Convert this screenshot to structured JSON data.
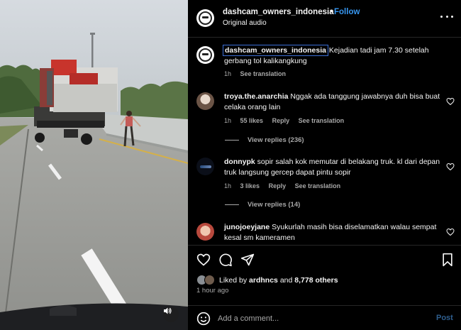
{
  "header": {
    "username": "dashcam_owners_indonesia",
    "separator": "•",
    "follow_label": "Follow",
    "audio_label": "Original audio",
    "more_icon": "more-horizontal-icon"
  },
  "caption": {
    "username": "dashcam_owners_indonesia",
    "text": "Kejadian tadi jam 7.30 setelah gerbang tol kalikangkung",
    "time": "1h",
    "see_translation": "See translation"
  },
  "comments": [
    {
      "username": "troya.the.anarchia",
      "text": "Nggak ada tanggung jawabnya duh bisa buat celaka orang lain",
      "time": "1h",
      "likes": "55 likes",
      "reply": "Reply",
      "see_translation": "See translation",
      "view_replies": "View replies (236)"
    },
    {
      "username": "donnypk",
      "text": "sopir salah kok memutar di belakang truk. kl dari depan truk langsung gercep dapat pintu sopir",
      "time": "1h",
      "likes": "3 likes",
      "reply": "Reply",
      "see_translation": "See translation",
      "view_replies": "View replies (14)"
    },
    {
      "username": "junojoeyjane",
      "text": "Syukurlah masih bisa diselamatkan walau sempat kesal sm kameramen"
    }
  ],
  "actions": {
    "like_icon": "heart-icon",
    "comment_icon": "comment-icon",
    "share_icon": "send-icon",
    "save_icon": "bookmark-icon"
  },
  "likes": {
    "prefix": "Liked by",
    "user": "ardhncs",
    "conj": "and",
    "others": "8,778 others"
  },
  "time_ago": "1 hour ago",
  "add_comment": {
    "placeholder": "Add a comment...",
    "post_label": "Post"
  },
  "colors": {
    "follow": "#3797f0",
    "post_disabled": "#2f5f8f",
    "background": "#000000",
    "secondary_text": "#a8a8a8"
  }
}
